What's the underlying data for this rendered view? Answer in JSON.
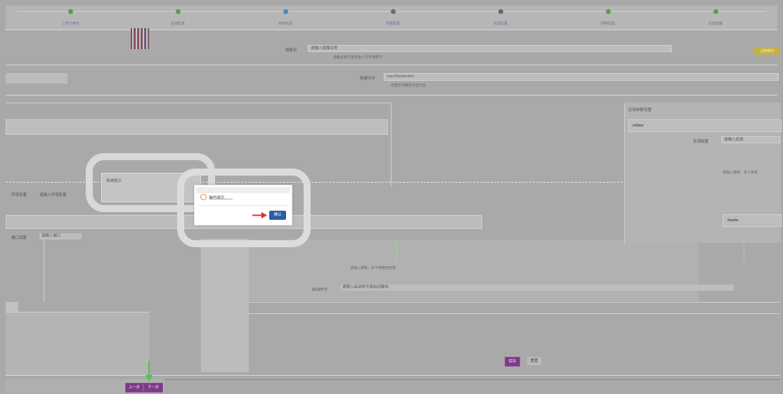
{
  "steps": [
    {
      "label": "上传应用包",
      "color": "#5a9e4a"
    },
    {
      "label": "应用配置",
      "color": "#5a9e4a"
    },
    {
      "label": "镜像构建",
      "color": "#3a8fc8"
    },
    {
      "label": "部署配置",
      "color": "#6b6b6b"
    },
    {
      "label": "资源配置",
      "color": "#6b6b6b"
    },
    {
      "label": "网络配置",
      "color": "#5a9e4a"
    },
    {
      "label": "完成部署",
      "color": "#5a9e4a"
    }
  ],
  "form": {
    "image_label": "镜像名",
    "image_value": "请输入镜像名称",
    "image_hint": "镜像名称只能包含小写字母数字",
    "right_tag": "上传成功",
    "dockerfile_label": "构建文件",
    "dockerfile_value": "/var/lib/docker",
    "dockerfile_hint": "构建文件路径不能为空",
    "port_label": "端口设置",
    "port_value": "请输入端口",
    "env_label": "环境变量",
    "env_value": "请输入环境变量",
    "arg1_hint": "请输入参数，多个参数用空格",
    "startup_label": "启动命令",
    "startup_value": "请输入启动命令或启动脚本"
  },
  "right_panel": {
    "title": "应用参数设置",
    "group1": "relax",
    "group1_label": "资源配置",
    "group1_value": "请输入资源",
    "group1_hint": "请输入参数，多个参数",
    "group2": "tools"
  },
  "dialog": {
    "title": "系统提示",
    "message": "操作成功",
    "ok_label": "确认",
    "arrow_color": "#e0302a"
  },
  "actions": {
    "save": "保存",
    "reset": "重置",
    "prev": "上一步",
    "next": "下一步",
    "arrow_color": "#3bd13b"
  }
}
